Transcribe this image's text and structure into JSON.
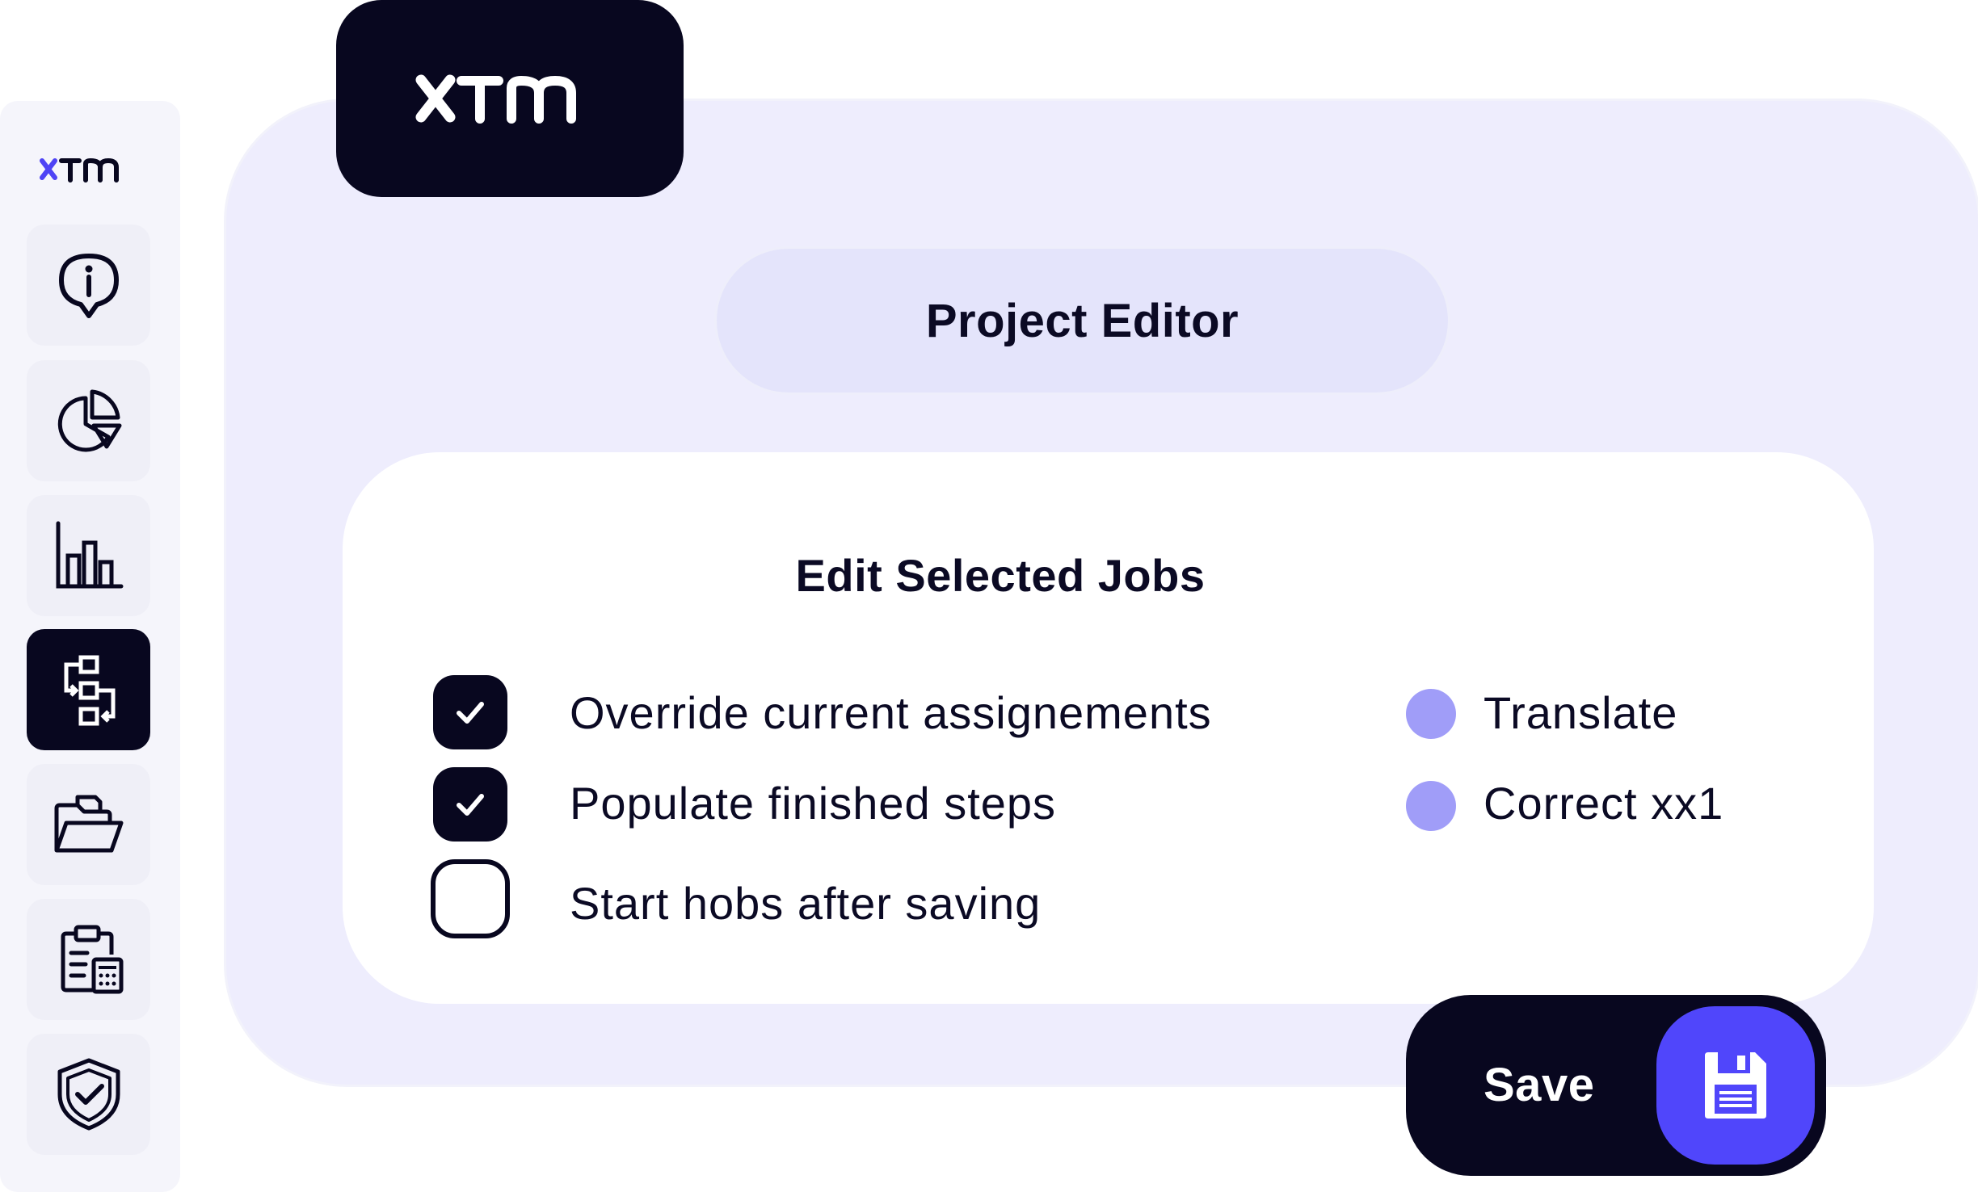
{
  "brand": {
    "logo_text": "xtm"
  },
  "sidebar": {
    "items": [
      {
        "icon": "info-pin-icon",
        "active": false
      },
      {
        "icon": "pie-chart-icon",
        "active": false
      },
      {
        "icon": "bar-chart-icon",
        "active": false
      },
      {
        "icon": "workflow-icon",
        "active": true
      },
      {
        "icon": "folder-icon",
        "active": false
      },
      {
        "icon": "clipboard-calculator-icon",
        "active": false
      },
      {
        "icon": "shield-check-icon",
        "active": false
      }
    ]
  },
  "header": {
    "title": "Project Editor"
  },
  "dialog": {
    "title": "Edit Selected Jobs",
    "options": [
      {
        "label": "Override current assignements",
        "checked": true
      },
      {
        "label": "Populate finished steps",
        "checked": true
      },
      {
        "label": "Start hobs after saving",
        "checked": false
      }
    ],
    "steps": [
      {
        "label": "Translate"
      },
      {
        "label": "Correct xx1"
      }
    ]
  },
  "actions": {
    "save_label": "Save",
    "save_icon": "floppy-disk-icon"
  },
  "colors": {
    "dark": "#08071f",
    "accent": "#5046fb",
    "dot": "#a09df8",
    "panel": "#eeedfd",
    "pill": "#e4e4fb"
  }
}
